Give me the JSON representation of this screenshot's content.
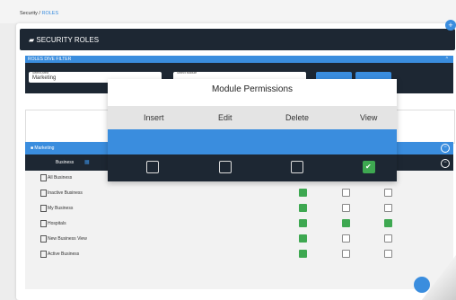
{
  "breadcrumb": {
    "root": "Security",
    "sep": "/",
    "current": "ROLES"
  },
  "header": {
    "title": "SECURITY ROLES"
  },
  "filter": {
    "title": "ROLES DIVE FILTER",
    "area_label": "Select Area",
    "area_value": "Marketing",
    "module_label": "Select Module"
  },
  "modal": {
    "title": "Module Permissions",
    "columns": [
      "Insert",
      "Edit",
      "Delete",
      "View"
    ],
    "checks": [
      false,
      false,
      false,
      true
    ]
  },
  "tree": {
    "group": "Marketing",
    "selected": "Business",
    "rows": [
      {
        "label": "All Business",
        "checks": [
          false,
          false,
          false
        ]
      },
      {
        "label": "Inactive Business",
        "checks": [
          true,
          false,
          false
        ]
      },
      {
        "label": "My Business",
        "checks": [
          true,
          false,
          false
        ]
      },
      {
        "label": "Hospitals",
        "checks": [
          true,
          true,
          true
        ]
      },
      {
        "label": "New Business View",
        "checks": [
          true,
          false,
          false
        ]
      },
      {
        "label": "Active Business",
        "checks": [
          true,
          false,
          false
        ]
      }
    ]
  }
}
